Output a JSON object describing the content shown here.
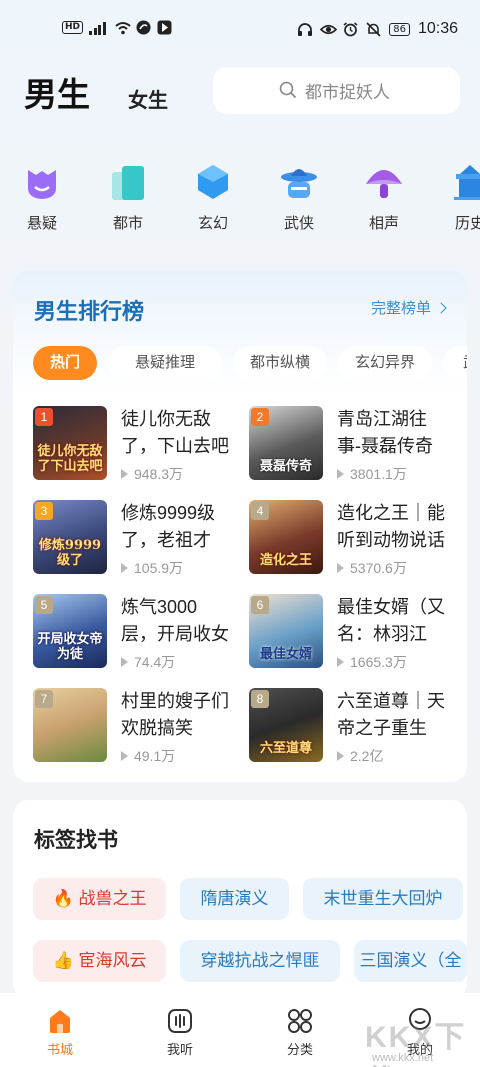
{
  "status_bar": {
    "left_icons": [
      "hd-icon",
      "signal-icon",
      "wifi-icon",
      "app-icon-1",
      "app-icon-2"
    ],
    "hd": "HD",
    "battery": "86",
    "time": "10:36",
    "right_icons": [
      "headphones-icon",
      "eye-icon",
      "alarm-icon",
      "mute-icon",
      "battery-icon"
    ]
  },
  "header": {
    "tab_male": "男生",
    "tab_female": "女生",
    "search_placeholder": "都市捉妖人"
  },
  "categories": [
    {
      "label": "悬疑",
      "icon": "suspense-icon",
      "color": "#8a5cf6"
    },
    {
      "label": "都市",
      "icon": "city-icon",
      "color": "#38c7c9"
    },
    {
      "label": "玄幻",
      "icon": "fantasy-icon",
      "color": "#2f9bf0"
    },
    {
      "label": "武侠",
      "icon": "martial-icon",
      "color": "#3a8fe8"
    },
    {
      "label": "相声",
      "icon": "crosstalk-icon",
      "color": "#a35ce6"
    },
    {
      "label": "历史",
      "icon": "history-icon",
      "color": "#2b86e0"
    }
  ],
  "ranking": {
    "title": "男生排行榜",
    "more": "完整榜单",
    "chips": [
      "热门",
      "悬疑推理",
      "都市纵横",
      "玄幻异界",
      "武侠"
    ],
    "books": [
      {
        "rank": "1",
        "title": "徒儿你无敌了，下山去吧",
        "plays": "948.3万",
        "cover_text": "徒儿你无敌了下山去吧",
        "cover_color": "#6b3a2a",
        "badge_color": "#e8502e"
      },
      {
        "rank": "2",
        "title": "青岛江湖往事-聂磊传奇",
        "plays": "3801.1万",
        "cover_text": "聂磊传奇",
        "cover_color": "#4a4a4a",
        "badge_color": "#f07a2a"
      },
      {
        "rank": "3",
        "title": "修炼9999级了，老祖才100级",
        "plays": "105.9万",
        "cover_text": "修炼9999级了",
        "cover_color": "#3b4a7a",
        "badge_color": "#f5a623"
      },
      {
        "rank": "4",
        "title": "造化之王｜能听到动物说话",
        "plays": "5370.6万",
        "cover_text": "造化之王",
        "cover_color": "#7a3a2a",
        "badge_color": "#b8a98a"
      },
      {
        "rank": "5",
        "title": "炼气3000层，开局收女帝为徒",
        "plays": "74.4万",
        "cover_text": "开局收女帝为徒",
        "cover_color": "#3a5aa0",
        "badge_color": "#b8a98a"
      },
      {
        "rank": "6",
        "title": "最佳女婿（又名：林羽江颜）",
        "plays": "1665.3万",
        "cover_text": "最佳女婿",
        "cover_color": "#6aa0c8",
        "badge_color": "#b8a98a"
      },
      {
        "rank": "7",
        "title": "村里的嫂子们欢脱搞笑",
        "plays": "49.1万",
        "cover_text": "",
        "cover_color": "#c8a070",
        "badge_color": "#b8a98a"
      },
      {
        "rank": "8",
        "title": "六至道尊｜天帝之子重生",
        "plays": "2.2亿",
        "cover_text": "六至道尊",
        "cover_color": "#2a2a2a",
        "badge_color": "#b8a98a"
      }
    ]
  },
  "tags_section": {
    "title": "标签找书",
    "row1": [
      {
        "label": "战兽之王",
        "prefix": "🔥",
        "hot": true
      },
      {
        "label": "隋唐演义",
        "prefix": "",
        "hot": false
      },
      {
        "label": "末世重生大回炉",
        "prefix": "",
        "hot": false
      }
    ],
    "row2": [
      {
        "label": "宦海风云",
        "prefix": "👍",
        "hot": true
      },
      {
        "label": "穿越抗战之悍匪",
        "prefix": "",
        "hot": false
      },
      {
        "label": "三国演义（全",
        "prefix": "",
        "hot": false
      }
    ]
  },
  "bottom_nav": [
    {
      "label": "书城",
      "icon": "bookstore-icon",
      "active": true
    },
    {
      "label": "我听",
      "icon": "listen-icon",
      "active": false
    },
    {
      "label": "分类",
      "icon": "category-icon",
      "active": false
    },
    {
      "label": "我的",
      "icon": "profile-icon",
      "active": false
    }
  ],
  "watermark": {
    "main": "KKX下载",
    "sub": "www.kkx.net"
  }
}
